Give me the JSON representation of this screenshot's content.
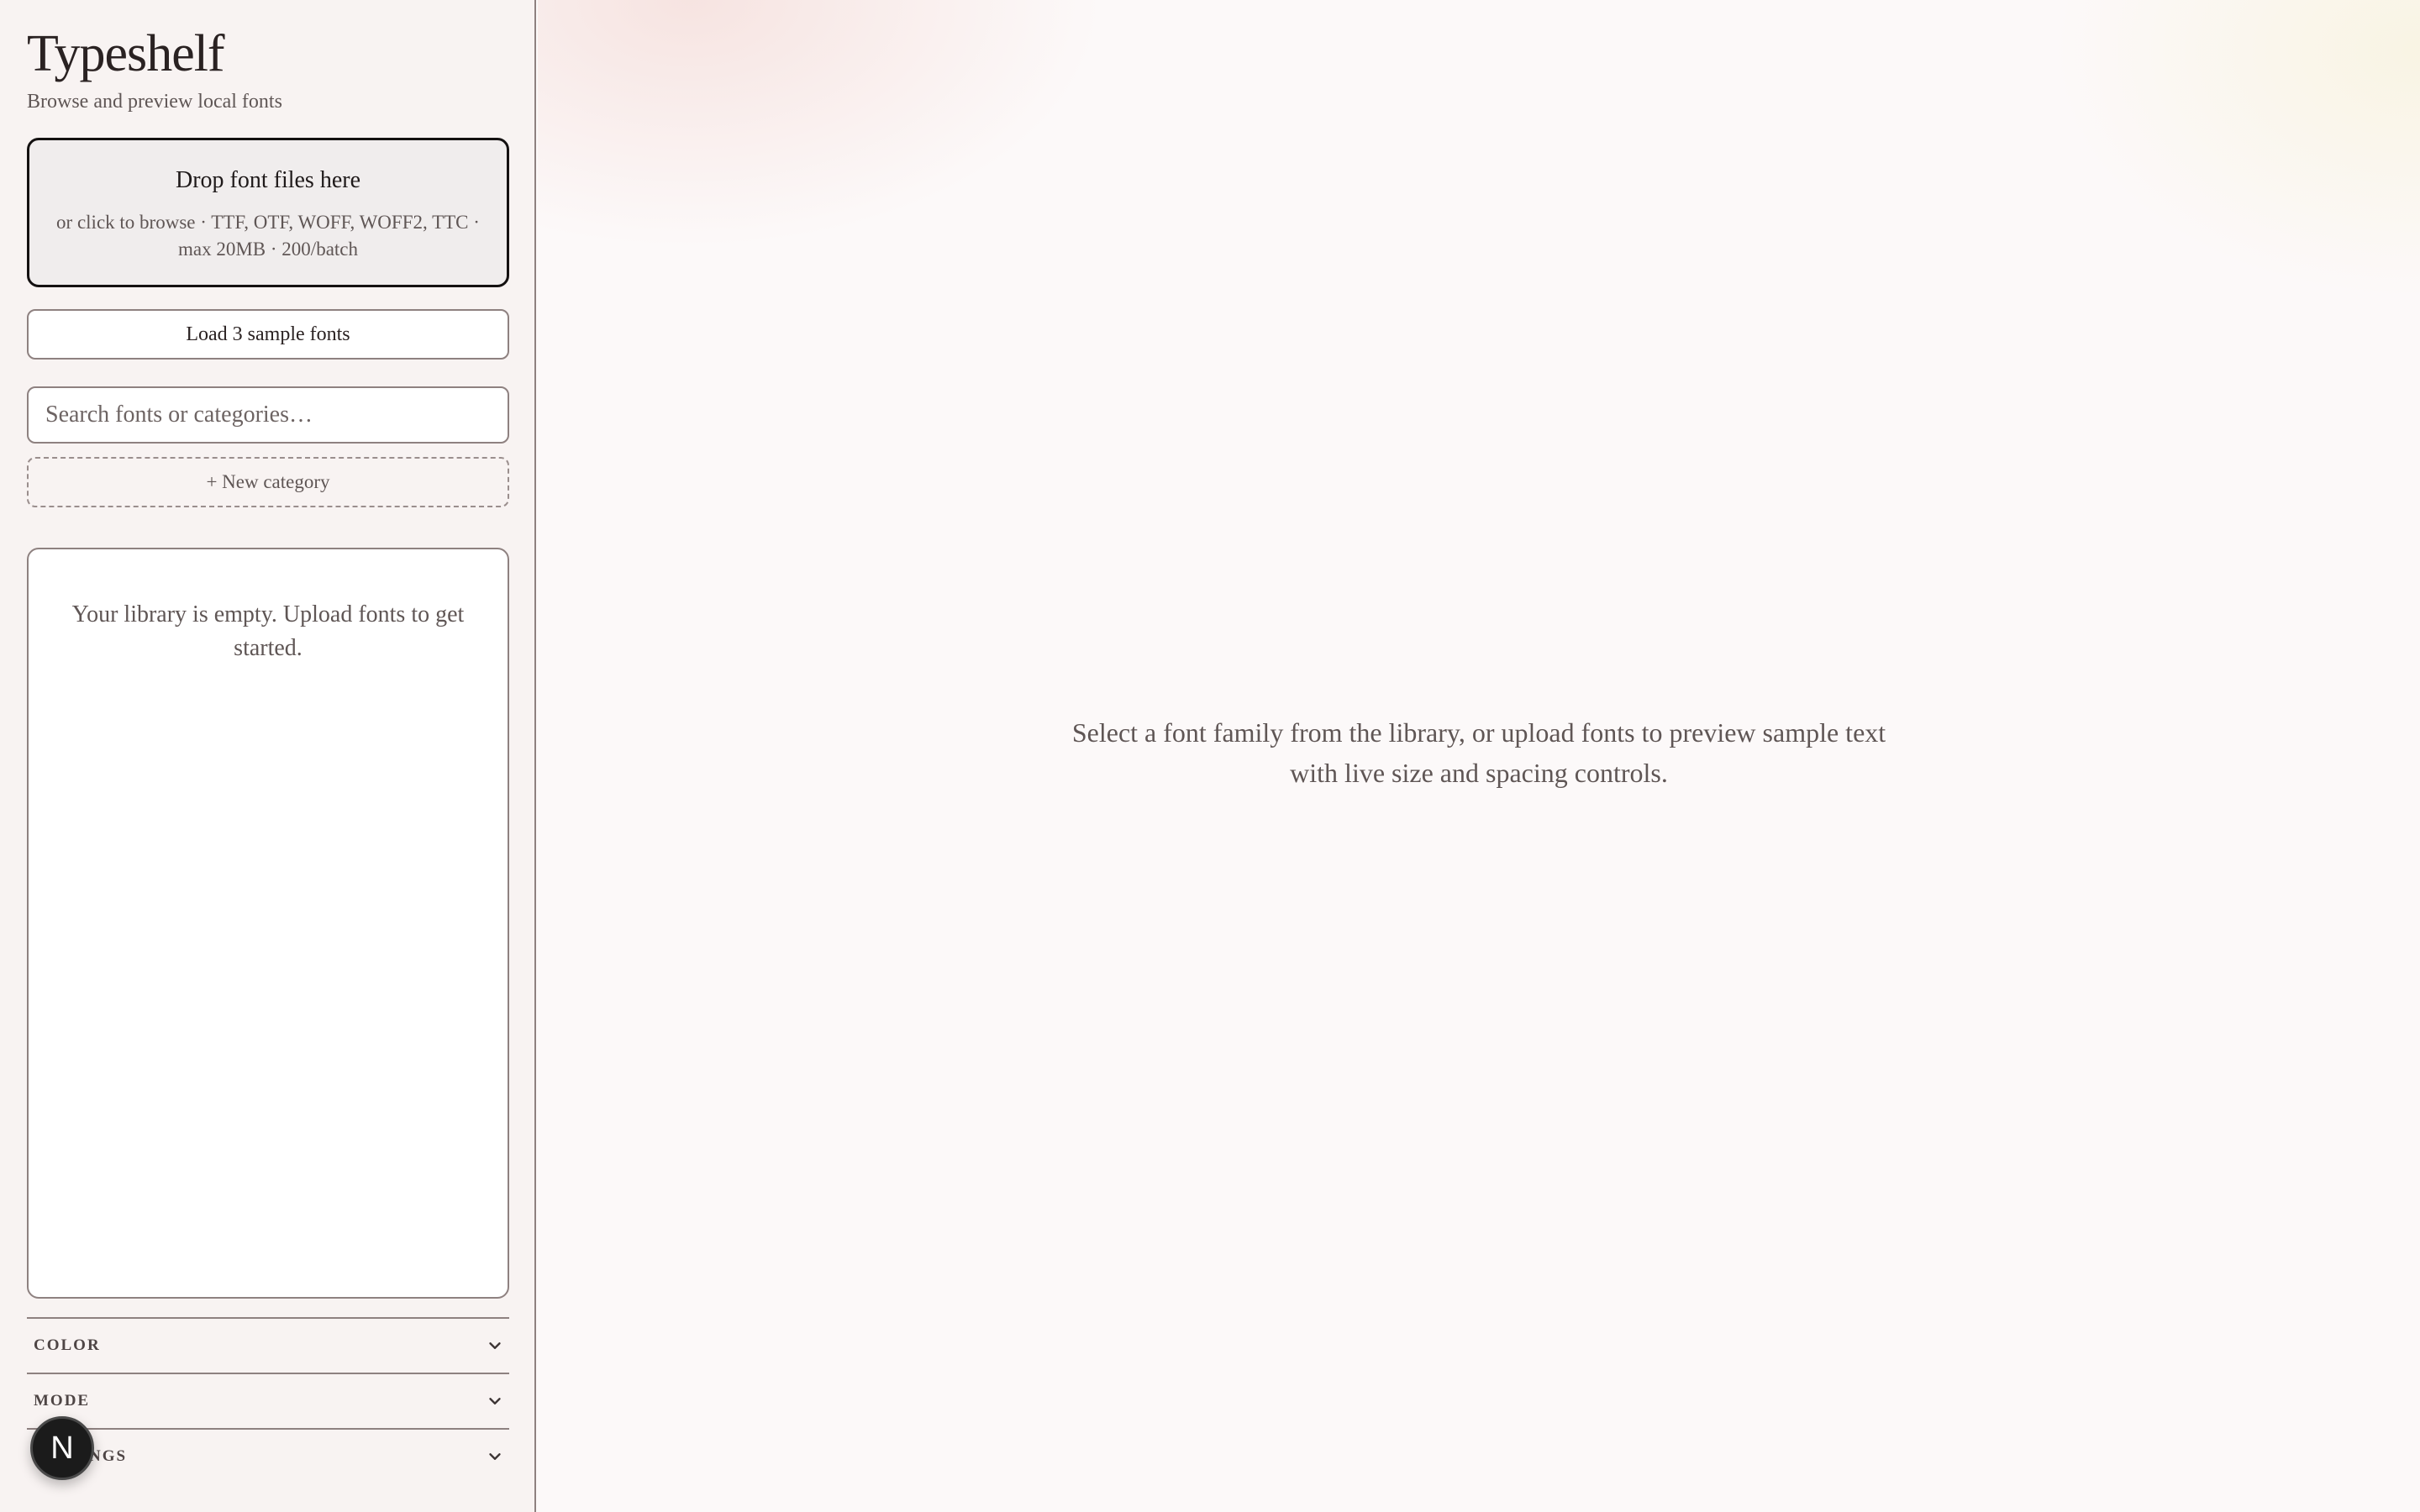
{
  "sidebar": {
    "title": "Typeshelf",
    "subtitle": "Browse and preview local fonts",
    "dropzone": {
      "title": "Drop font files here",
      "subtitle": "or click to browse · TTF, OTF, WOFF, WOFF2, TTC · max 20MB · 200/batch"
    },
    "sample_button": "Load 3 sample fonts",
    "search_placeholder": "Search fonts or categories…",
    "new_category": "+ New category",
    "library_empty": "Your library is empty. Upload fonts to get started.",
    "sections": {
      "color": "COLOR",
      "mode": "MODE",
      "settings": "SETTINGS"
    },
    "icons": {
      "section_toggle": "chevron-down-icon"
    }
  },
  "avatar": {
    "letter": "N"
  },
  "main": {
    "empty_hint": "Select a font family from the library, or upload fonts to preview sample text with live size and spacing controls."
  }
}
